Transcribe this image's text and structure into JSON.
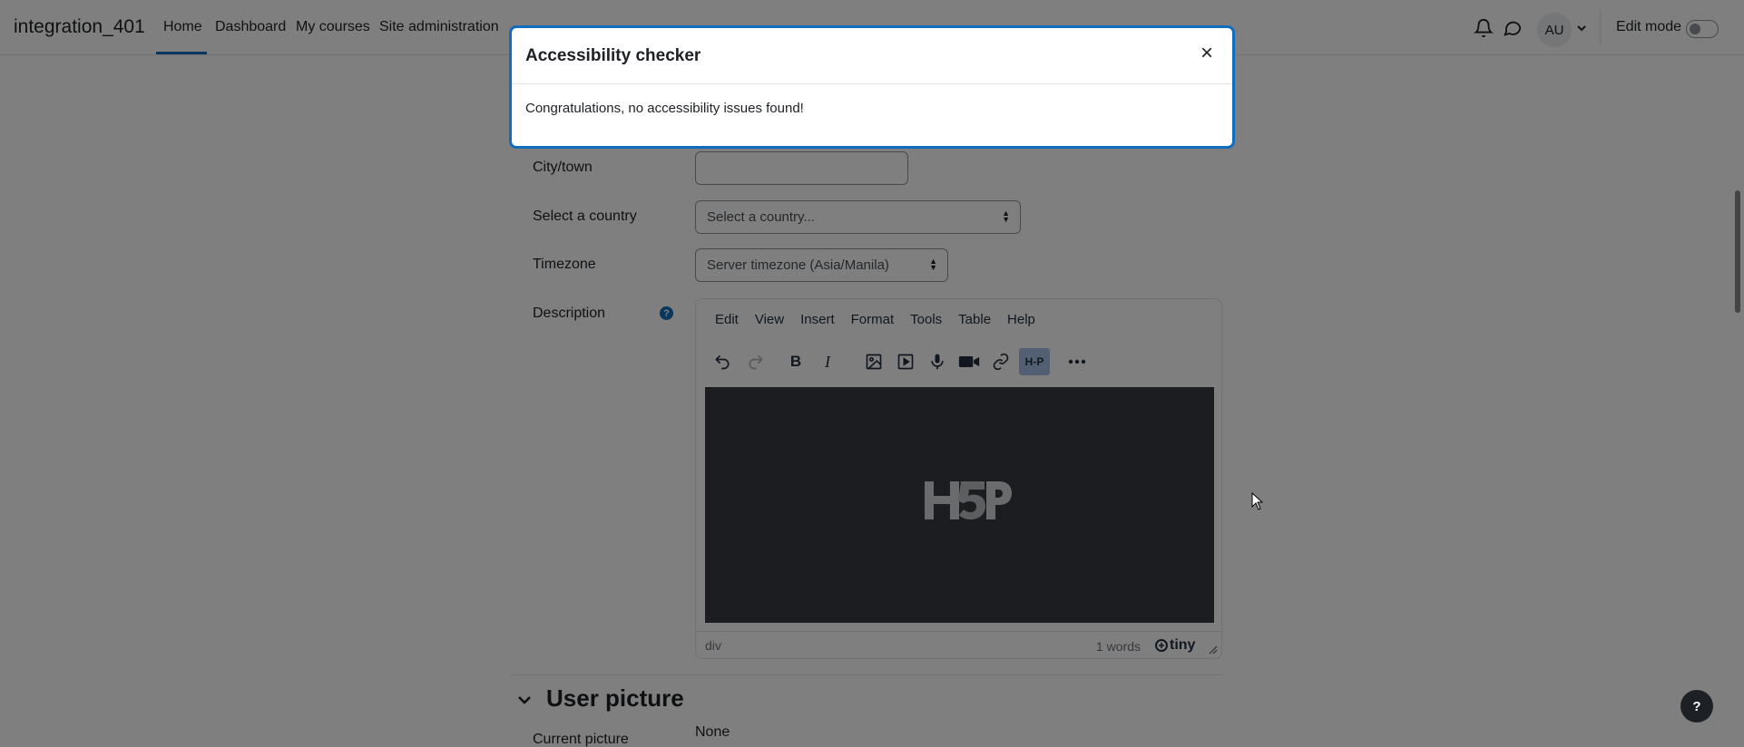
{
  "navbar": {
    "site_name": "integration_401",
    "links": [
      "Home",
      "Dashboard",
      "My courses",
      "Site administration"
    ],
    "avatar_initials": "AU",
    "edit_mode_label": "Edit mode"
  },
  "form": {
    "city_label": "City/town",
    "city_value": "",
    "country_label": "Select a country",
    "country_value": "Select a country...",
    "timezone_label": "Timezone",
    "timezone_value": "Server timezone (Asia/Manila)",
    "description_label": "Description",
    "help_glyph": "?"
  },
  "editor": {
    "menus": [
      "Edit",
      "View",
      "Insert",
      "Format",
      "Tools",
      "Table",
      "Help"
    ],
    "toolbar_icons": [
      "undo-icon",
      "redo-icon",
      "bold-icon",
      "italic-icon",
      "image-icon",
      "media-icon",
      "record-audio-icon",
      "record-video-icon",
      "link-icon",
      "h5p-icon",
      "more-icon"
    ],
    "bold_glyph": "B",
    "italic_glyph": "I",
    "h5p_label": "H-P",
    "status_path": "div",
    "word_count": "1 words",
    "brand": "tiny"
  },
  "user_picture": {
    "section_title": "User picture",
    "current_picture_label": "Current picture",
    "current_picture_value": "None"
  },
  "dialog": {
    "title": "Accessibility checker",
    "close_glyph": "×",
    "message": "Congratulations, no accessibility issues found!"
  },
  "help_fab_glyph": "?",
  "colors": {
    "primary": "#0f6cbf",
    "editor_bg": "#373a40",
    "active_button": "#a6c1e6"
  }
}
